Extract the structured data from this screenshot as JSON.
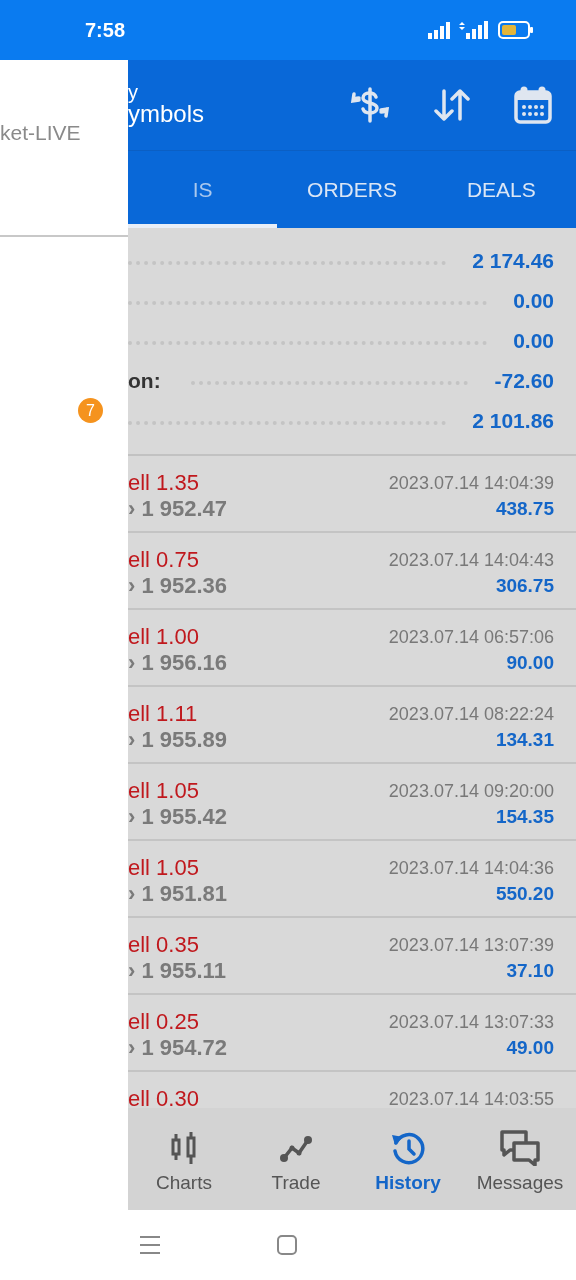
{
  "status_bar": {
    "time": "7:58"
  },
  "drawer": {
    "account": "ket-LIVE",
    "badge": "7"
  },
  "header": {
    "title_lines": [
      "y",
      "ymbols"
    ]
  },
  "tabs": [
    {
      "label": "IS",
      "selected": true
    },
    {
      "label": "ORDERS",
      "selected": false
    },
    {
      "label": "DEALS",
      "selected": false
    }
  ],
  "summary": [
    {
      "value": "2 174.46"
    },
    {
      "value": "0.00"
    },
    {
      "value": "0.00"
    },
    {
      "label": "on:",
      "value": "-72.60"
    },
    {
      "value": "2 101.86"
    }
  ],
  "deals": [
    {
      "side": "ell 1.35",
      "price": "› 1 952.47",
      "time": "2023.07.14 14:04:39",
      "profit": "438.75"
    },
    {
      "side": "ell 0.75",
      "price": "› 1 952.36",
      "time": "2023.07.14 14:04:43",
      "profit": "306.75"
    },
    {
      "side": "ell 1.00",
      "price": "› 1 956.16",
      "time": "2023.07.14 06:57:06",
      "profit": "90.00"
    },
    {
      "side": "ell 1.11",
      "price": "› 1 955.89",
      "time": "2023.07.14 08:22:24",
      "profit": "134.31"
    },
    {
      "side": "ell 1.05",
      "price": "› 1 955.42",
      "time": "2023.07.14 09:20:00",
      "profit": "154.35"
    },
    {
      "side": "ell 1.05",
      "price": "› 1 951.81",
      "time": "2023.07.14 14:04:36",
      "profit": "550.20"
    },
    {
      "side": "ell 0.35",
      "price": "› 1 955.11",
      "time": "2023.07.14 13:07:39",
      "profit": "37.10"
    },
    {
      "side": "ell 0.25",
      "price": "› 1 954.72",
      "time": "2023.07.14 13:07:33",
      "profit": "49.00"
    },
    {
      "side": "ell 0.30",
      "time": "2023.07.14 14:03:55"
    }
  ],
  "bottom_nav": [
    {
      "label": "Charts",
      "kind": "charts",
      "selected": false
    },
    {
      "label": "Trade",
      "kind": "trade",
      "selected": false
    },
    {
      "label": "History",
      "kind": "history",
      "selected": true
    },
    {
      "label": "Messages",
      "kind": "messages",
      "selected": false
    }
  ]
}
